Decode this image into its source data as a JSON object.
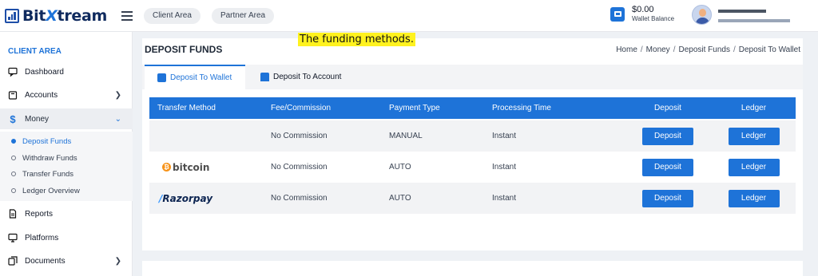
{
  "header": {
    "brand_prefix": "Bit",
    "brand_x": "X",
    "brand_suffix": "tream",
    "nav": [
      "Client Area",
      "Partner Area"
    ],
    "wallet": {
      "amount": "$0.00",
      "label": "Wallet Balance"
    }
  },
  "sidebar": {
    "section_title": "CLIENT AREA",
    "items": [
      {
        "label": "Dashboard",
        "icon": "monitor-chat-icon"
      },
      {
        "label": "Accounts",
        "icon": "briefcase-icon"
      },
      {
        "label": "Money",
        "icon": "dollar-icon"
      },
      {
        "label": "Reports",
        "icon": "document-icon"
      },
      {
        "label": "Platforms",
        "icon": "desktop-icon"
      },
      {
        "label": "Documents",
        "icon": "copy-icon"
      }
    ],
    "money_sub_items": [
      "Deposit Funds",
      "Withdraw Funds",
      "Transfer Funds",
      "Ledger Overview"
    ]
  },
  "page": {
    "title": "DEPOSIT FUNDS",
    "annotation": "The funding methods.",
    "breadcrumb": [
      "Home",
      "Money",
      "Deposit Funds",
      "Deposit To Wallet"
    ],
    "tabs": [
      "Deposit To Wallet",
      "Deposit To Account"
    ]
  },
  "table": {
    "headers": [
      "Transfer Method",
      "Fee/Commission",
      "Payment Type",
      "Processing Time",
      "Deposit",
      "Ledger"
    ],
    "rows": [
      {
        "method": "",
        "fee": "No Commission",
        "type": "MANUAL",
        "time": "Instant",
        "deposit": "Deposit",
        "ledger": "Ledger"
      },
      {
        "method": "bitcoin",
        "fee": "No Commission",
        "type": "AUTO",
        "time": "Instant",
        "deposit": "Deposit",
        "ledger": "Ledger"
      },
      {
        "method": "Razorpay",
        "fee": "No Commission",
        "type": "AUTO",
        "time": "Instant",
        "deposit": "Deposit",
        "ledger": "Ledger"
      }
    ]
  },
  "colors": {
    "accent": "#1e73d8",
    "annotation_bg": "#fff21f"
  }
}
